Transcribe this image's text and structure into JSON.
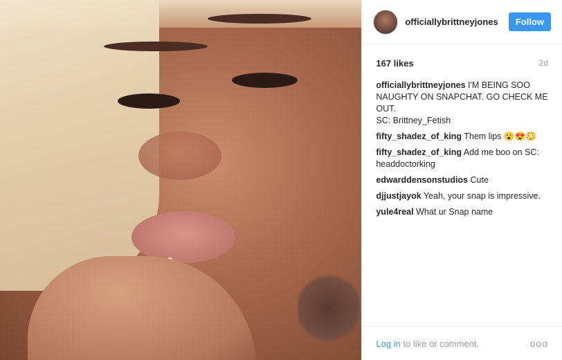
{
  "post": {
    "username": "officiallybrittneyjones",
    "follow_label": "Follow",
    "likes": "167 likes",
    "time": "2d",
    "caption_user": "officiallybrittneyjones",
    "caption_line1": "I'M BEING SOO NAUGHTY ON SNAPCHAT. GO CHECK ME OUT.",
    "caption_line2": "SC: Brittney_Fetish",
    "comments": [
      {
        "user": "fifty_shadez_of_king",
        "text": "Them lips 😮😍😳"
      },
      {
        "user": "fifty_shadez_of_king",
        "text": "Add me boo on SC: headdoctorking"
      },
      {
        "user": "edwarddensonstudios",
        "text": "Cute"
      },
      {
        "user": "djjustjayok",
        "text": "Yeah, your snap is impressive."
      },
      {
        "user": "yule4real",
        "text": "What ur Snap name"
      }
    ],
    "login_link": "Log in",
    "login_rest": " to like or comment.",
    "more_glyph": "ooo"
  },
  "icons": {
    "more": "more-options-icon"
  }
}
